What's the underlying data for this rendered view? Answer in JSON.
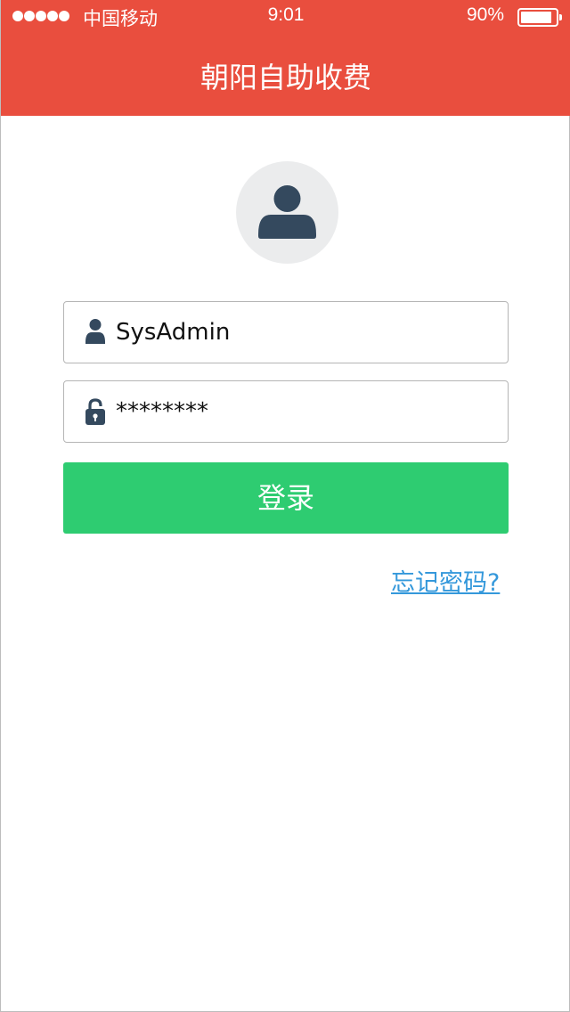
{
  "status_bar": {
    "carrier": "中国移动",
    "time": "9:01",
    "battery_percent": "90%",
    "battery_level": 0.9,
    "signal_bars": 5
  },
  "header": {
    "title": "朝阳自助收费",
    "background_color": "#e94e3e"
  },
  "avatar": {
    "icon": "user-icon"
  },
  "form": {
    "username": {
      "value": "SysAdmin",
      "icon": "user-icon"
    },
    "password": {
      "value": "********",
      "icon": "lock-icon"
    },
    "login_label": "登录",
    "login_color": "#2ecc71",
    "forgot_label": "忘记密码?",
    "link_color": "#3498db"
  }
}
